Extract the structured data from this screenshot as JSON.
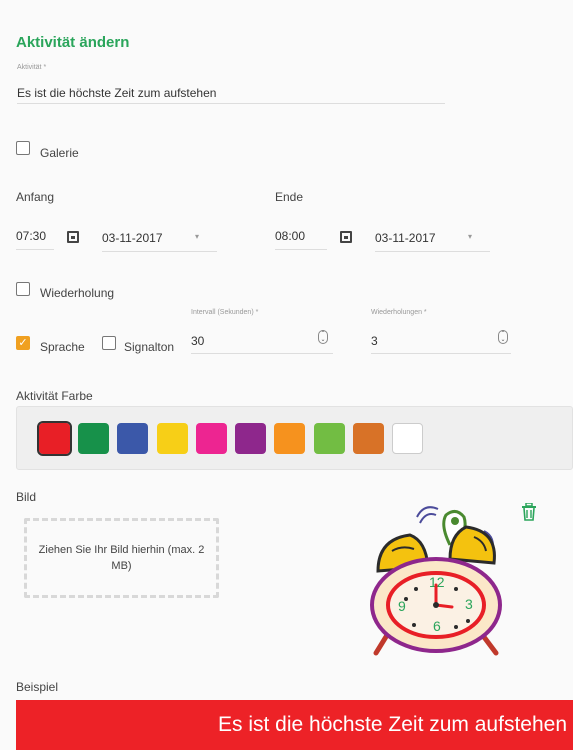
{
  "form": {
    "title": "Aktivität ändern",
    "activity_label": "Aktivität *",
    "activity_value": "Es ist die höchste Zeit zum aufstehen"
  },
  "galerie": {
    "label": "Galerie",
    "checked": false
  },
  "anfang": {
    "label": "Anfang",
    "time": "07:30",
    "date": "03-11-2017"
  },
  "ende": {
    "label": "Ende",
    "time": "08:00",
    "date": "03-11-2017"
  },
  "wiederholung": {
    "label": "Wiederholung",
    "checked": false
  },
  "sprache": {
    "label": "Sprache",
    "checked": true
  },
  "signalton": {
    "label": "Signalton",
    "checked": false
  },
  "intervall": {
    "label": "Intervall (Sekunden) *",
    "value": "30"
  },
  "wiederholungen": {
    "label": "Wiederholungen *",
    "value": "3"
  },
  "farbe": {
    "label": "Aktivität Farbe",
    "selected_color": "#e81f26",
    "swatches": [
      "#e81f26",
      "#17914a",
      "#3b58a9",
      "#f7cf17",
      "#ed2591",
      "#8e278c",
      "#f6921e",
      "#72bd43",
      "#d87227",
      "#ffffff"
    ]
  },
  "bild": {
    "label": "Bild",
    "dropzone_text": "Ziehen Sie Ihr Bild hierhin (max. 2 MB)",
    "image_icon": "alarm-clock-icon",
    "delete_icon": "trash-icon",
    "clock_numbers": [
      "12",
      "3",
      "6",
      "9"
    ]
  },
  "beispiel": {
    "label": "Beispiel",
    "banner_text": "Es ist die höchste Zeit zum aufstehen",
    "banner_color": "#ed2227"
  },
  "accent_color": "#2aa55b"
}
